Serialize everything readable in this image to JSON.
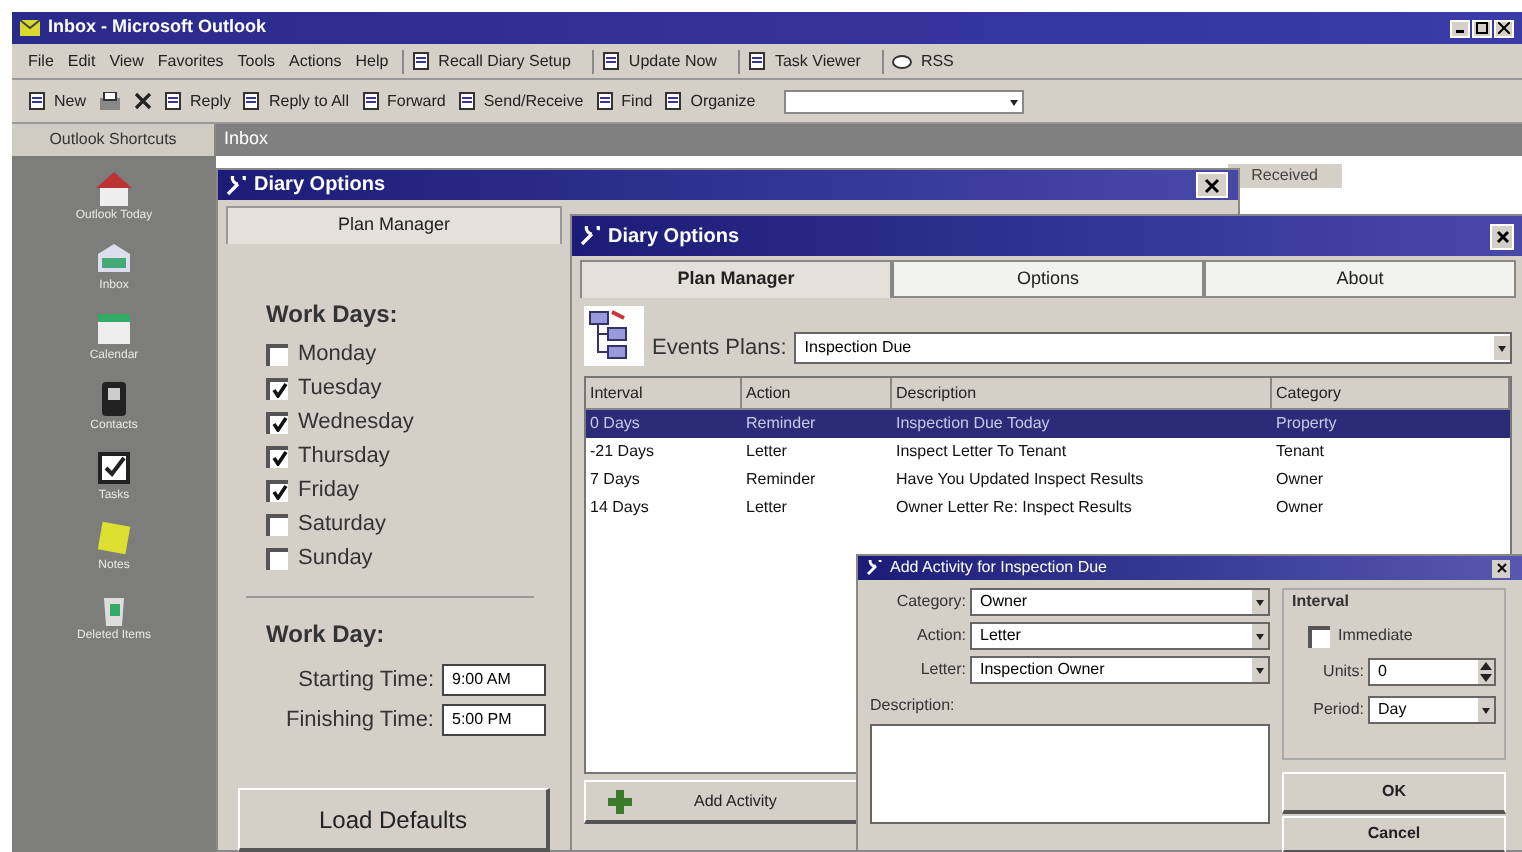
{
  "window": {
    "title": "Inbox - Microsoft Outlook"
  },
  "menu_bar": [
    "File",
    "Edit",
    "View",
    "Favorites",
    "Tools",
    "Actions",
    "Help"
  ],
  "toolbar_1": [
    {
      "label": "Recall Diary Setup"
    },
    {
      "label": "Update Now"
    },
    {
      "label": "Task Viewer"
    },
    {
      "label": "RSS"
    }
  ],
  "toolbar_2": [
    {
      "label": "New"
    },
    {
      "label": "Reply"
    },
    {
      "label": "Reply to All"
    },
    {
      "label": "Forward"
    },
    {
      "label": "Send/Receive"
    },
    {
      "label": "Find"
    },
    {
      "label": "Organize"
    }
  ],
  "shortcuts_header": "Outlook Shortcuts",
  "folder_title": "Inbox",
  "shortcuts": [
    "Outlook Today",
    "Inbox",
    "Calendar",
    "Contacts",
    "Tasks",
    "Notes",
    "Deleted Items"
  ],
  "message_list": {
    "column": "Received"
  },
  "diary_options_back": {
    "title": "Diary Options",
    "tab": "Plan Manager",
    "work_days_heading": "Work Days:",
    "work_days": [
      {
        "label": "Monday",
        "checked": false
      },
      {
        "label": "Tuesday",
        "checked": true
      },
      {
        "label": "Wednesday",
        "checked": true
      },
      {
        "label": "Thursday",
        "checked": true
      },
      {
        "label": "Friday",
        "checked": true
      },
      {
        "label": "Saturday",
        "checked": false
      },
      {
        "label": "Sunday",
        "checked": false
      }
    ],
    "work_day_heading": "Work Day:",
    "starting_time": {
      "label": "Starting Time:",
      "value": "9:00 AM"
    },
    "finishing_time": {
      "label": "Finishing Time:",
      "value": "5:00 PM"
    },
    "load_defaults_button": "Load Defaults"
  },
  "diary_options_front": {
    "title": "Diary Options",
    "tabs": [
      {
        "label": "Plan Manager",
        "selected": true
      },
      {
        "label": "Options",
        "selected": false
      },
      {
        "label": "About",
        "selected": false
      }
    ],
    "events_plans": {
      "label": "Events Plans:",
      "value": "Inspection Due"
    },
    "table": {
      "columns": [
        "Interval",
        "Action",
        "Description",
        "Category"
      ],
      "rows": [
        {
          "cells": [
            "0 Days",
            "Reminder",
            "Inspection Due Today",
            "Property"
          ],
          "selected": true
        },
        {
          "cells": [
            "-21 Days",
            "Letter",
            "Inspect Letter To Tenant",
            "Tenant"
          ],
          "selected": false
        },
        {
          "cells": [
            "7 Days",
            "Reminder",
            "Have You Updated Inspect Results",
            "Owner"
          ],
          "selected": false
        },
        {
          "cells": [
            "14 Days",
            "Letter",
            "Owner Letter Re: Inspect Results",
            "Owner"
          ],
          "selected": false
        }
      ]
    },
    "add_activity_button": "Add Activity"
  },
  "add_activity_dialog": {
    "title": "Add Activity for Inspection Due",
    "category": {
      "label": "Category:",
      "value": "Owner"
    },
    "action": {
      "label": "Action:",
      "value": "Letter"
    },
    "letter": {
      "label": "Letter:",
      "value": "Inspection Owner"
    },
    "description_label": "Description:",
    "interval_heading": "Interval",
    "immediate": {
      "label": "Immediate",
      "checked": false
    },
    "units": {
      "label": "Units:",
      "value": "0"
    },
    "period": {
      "label": "Period:",
      "value": "Day"
    },
    "ok_button": "OK",
    "cancel_button": "Cancel"
  }
}
